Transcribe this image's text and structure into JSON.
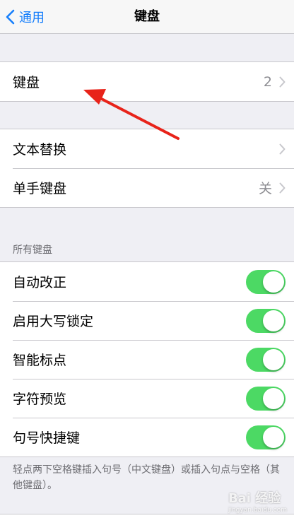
{
  "navbar": {
    "back_label": "通用",
    "title": "键盘"
  },
  "group1": {
    "keyboards_label": "键盘",
    "keyboards_value": "2"
  },
  "group2": {
    "text_replacement_label": "文本替换",
    "one_handed_label": "单手键盘",
    "one_handed_value": "关"
  },
  "all_keyboards": {
    "header": "所有键盘",
    "items": [
      {
        "label": "自动改正",
        "on": true
      },
      {
        "label": "启用大写锁定",
        "on": true
      },
      {
        "label": "智能标点",
        "on": true
      },
      {
        "label": "字符预览",
        "on": true
      },
      {
        "label": "句号快捷键",
        "on": true
      }
    ],
    "footer": "轻点两下空格键插入句号（中文键盘）或插入句点与空格（其他键盘）。"
  },
  "watermark": {
    "text": "Bai 经验",
    "sub": "jingyan.baidu.com"
  },
  "colors": {
    "accent": "#157efb",
    "toggle_on": "#4cd964",
    "annotation_arrow": "#e8231a"
  },
  "icons": [
    "back-chevron-icon",
    "chevron-right-icon",
    "red-arrow-annotation"
  ]
}
